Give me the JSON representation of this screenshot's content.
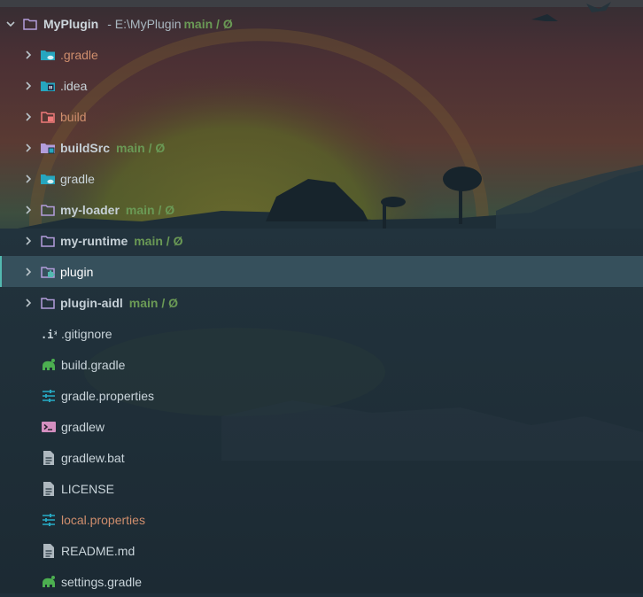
{
  "project": {
    "name": "MyPlugin",
    "path": "- E:\\MyPlugin",
    "vcs": "main / Ø"
  },
  "items": [
    {
      "label": ".gradle",
      "type": "folder",
      "style": "orange",
      "icon": "gradle-folder-icon",
      "vcs": null
    },
    {
      "label": ".idea",
      "type": "folder",
      "style": "normal",
      "icon": "idea-folder-icon",
      "vcs": null
    },
    {
      "label": "build",
      "type": "folder",
      "style": "orange",
      "icon": "build-folder-icon",
      "vcs": null
    },
    {
      "label": "buildSrc",
      "type": "folder",
      "style": "bold",
      "icon": "module-folder-icon",
      "vcs": "main / Ø"
    },
    {
      "label": "gradle",
      "type": "folder",
      "style": "normal",
      "icon": "gradle-folder-icon",
      "vcs": null
    },
    {
      "label": "my-loader",
      "type": "folder",
      "style": "bold",
      "icon": "folder-icon",
      "vcs": "main / Ø"
    },
    {
      "label": "my-runtime",
      "type": "folder",
      "style": "bold",
      "icon": "folder-icon",
      "vcs": "main / Ø"
    },
    {
      "label": "plugin",
      "type": "folder",
      "style": "white",
      "icon": "plugin-module-folder-icon",
      "vcs": null,
      "selected": true
    },
    {
      "label": "plugin-aidl",
      "type": "folder",
      "style": "bold",
      "icon": "folder-icon",
      "vcs": "main / Ø"
    },
    {
      "label": ".gitignore",
      "type": "file",
      "style": "normal",
      "icon": "gitignore-icon"
    },
    {
      "label": "build.gradle",
      "type": "file",
      "style": "normal",
      "icon": "gradle-elephant-icon"
    },
    {
      "label": "gradle.properties",
      "type": "file",
      "style": "normal",
      "icon": "properties-icon"
    },
    {
      "label": "gradlew",
      "type": "file",
      "style": "normal",
      "icon": "terminal-script-icon"
    },
    {
      "label": "gradlew.bat",
      "type": "file",
      "style": "normal",
      "icon": "text-file-icon"
    },
    {
      "label": "LICENSE",
      "type": "file",
      "style": "normal",
      "icon": "text-file-icon"
    },
    {
      "label": "local.properties",
      "type": "file",
      "style": "orange",
      "icon": "properties-icon"
    },
    {
      "label": "README.md",
      "type": "file",
      "style": "normal",
      "icon": "text-file-icon"
    },
    {
      "label": "settings.gradle",
      "type": "file",
      "style": "normal",
      "icon": "gradle-elephant-icon"
    }
  ],
  "colors": {
    "folder": "#b39ddb",
    "gradle_folder": "#26a6bf",
    "build_folder": "#ef7a7a",
    "vcs_branch": "#6a9955",
    "ignored_orange": "#cf8e6d",
    "selection": "#3e5c6a",
    "selection_accent": "#53b9b0"
  }
}
